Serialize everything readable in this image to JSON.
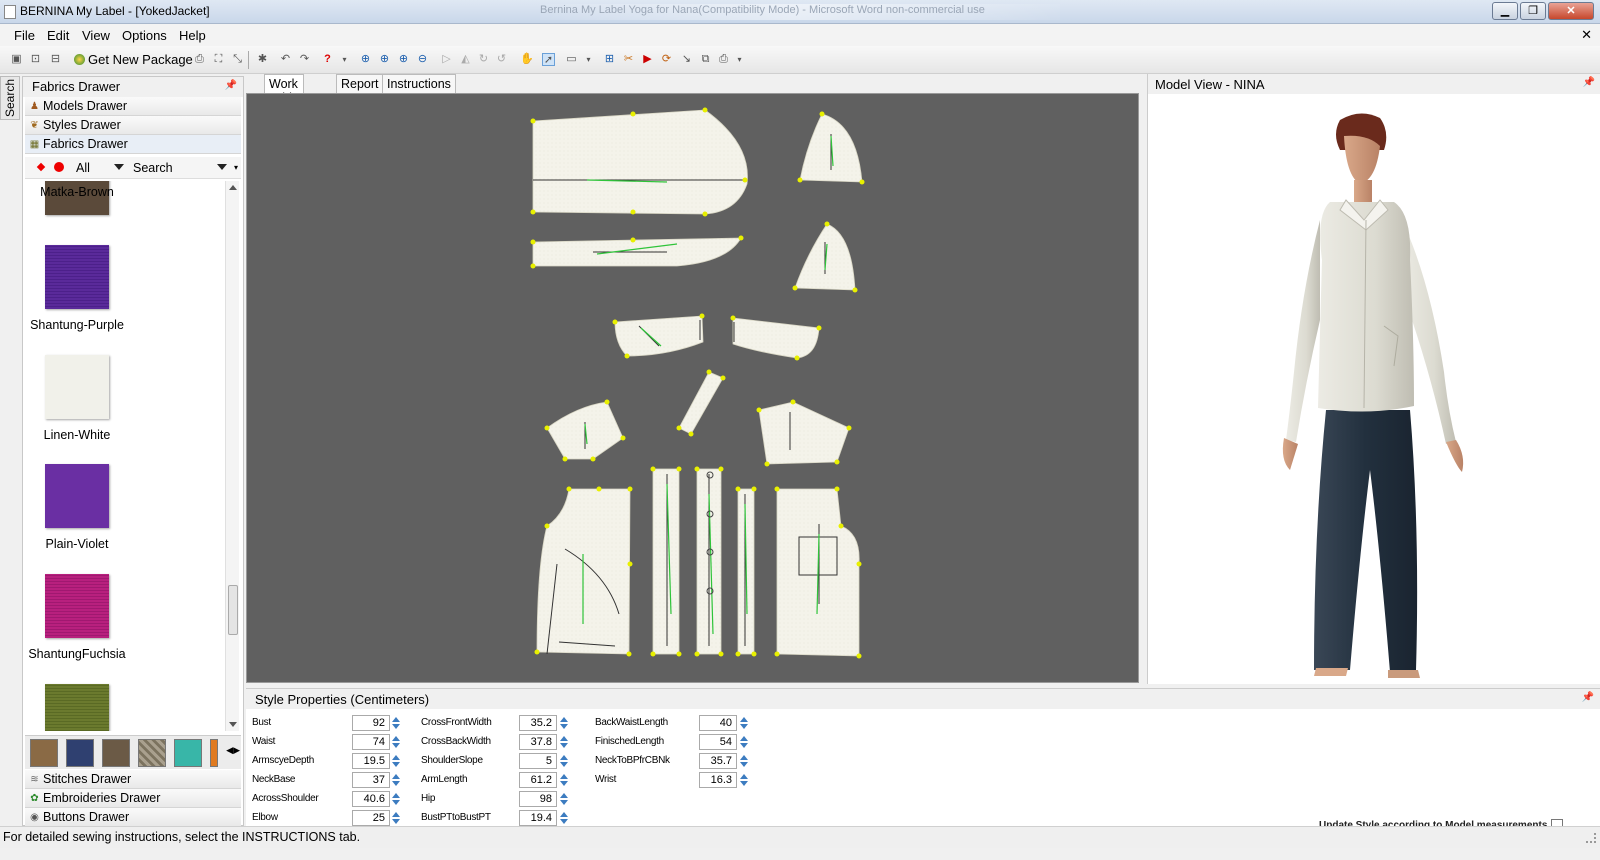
{
  "window": {
    "title": "BERNINA My Label - [YokedJacket]",
    "ghost_title": "Bernina My Label Yoga for Nana(Compatibility Mode) - Microsoft Word non-commercial use"
  },
  "menu": {
    "file": "File",
    "edit": "Edit",
    "view": "View",
    "options": "Options",
    "help": "Help",
    "close_glyph": "✕"
  },
  "toolbar": {
    "get_new_package": "Get New Package"
  },
  "search_tab": "Search",
  "left_panel": {
    "title": "Fabrics Drawer",
    "drawers_top": [
      {
        "label": "Models Drawer",
        "icon": "person-icon"
      },
      {
        "label": "Styles Drawer",
        "icon": "style-icon"
      },
      {
        "label": "Fabrics Drawer",
        "icon": "fabric-icon"
      }
    ],
    "filter_value": "All",
    "search_label": "Search",
    "fabrics": [
      {
        "name": "Matka-Brown",
        "color": "#5b4a3a"
      },
      {
        "name": "Shantung-Purple",
        "color": "#5a2a9a"
      },
      {
        "name": "Linen-White",
        "color": "#f1f1ea"
      },
      {
        "name": "Plain-Violet",
        "color": "#6a2fa3"
      },
      {
        "name": "ShantungFuchsia",
        "color": "#b8207e"
      },
      {
        "name": "",
        "color": "#6b7a2e"
      }
    ],
    "mini_swatches": [
      "#8a6a45",
      "#2f4070",
      "#6b5a46",
      "#a9a08e",
      "#38b6a8",
      "#e07a20"
    ],
    "drawers_bottom": [
      {
        "label": "Stitches Drawer",
        "icon": "stitch-icon"
      },
      {
        "label": "Embroideries Drawer",
        "icon": "embroidery-icon"
      },
      {
        "label": "Buttons Drawer",
        "icon": "button-icon"
      }
    ]
  },
  "tabs": [
    "Work Table",
    "Report",
    "Instructions"
  ],
  "model_view": {
    "title": "Model View - NINA"
  },
  "style_properties": {
    "title": "Style Properties (Centimeters)",
    "columns": [
      [
        {
          "label": "Bust",
          "value": "92"
        },
        {
          "label": "Waist",
          "value": "74"
        },
        {
          "label": "ArmscyeDepth",
          "value": "19.5"
        },
        {
          "label": "NeckBase",
          "value": "37"
        },
        {
          "label": "AcrossShoulder",
          "value": "40.6"
        },
        {
          "label": "Elbow",
          "value": "25"
        }
      ],
      [
        {
          "label": "CrossFrontWidth",
          "value": "35.2"
        },
        {
          "label": "CrossBackWidth",
          "value": "37.8"
        },
        {
          "label": "ShoulderSlope",
          "value": "5"
        },
        {
          "label": "ArmLength",
          "value": "61.2"
        },
        {
          "label": "Hip",
          "value": "98"
        },
        {
          "label": "BustPTtoBustPT",
          "value": "19.4"
        }
      ],
      [
        {
          "label": "BackWaistLength",
          "value": "40"
        },
        {
          "label": "FinischedLength",
          "value": "54"
        },
        {
          "label": "NeckToBPfrCBNk",
          "value": "35.7"
        },
        {
          "label": "Wrist",
          "value": "16.3"
        }
      ]
    ],
    "update_label": "Update Style according to Model measurements"
  },
  "status": "For detailed sewing instructions, select the INSTRUCTIONS tab."
}
